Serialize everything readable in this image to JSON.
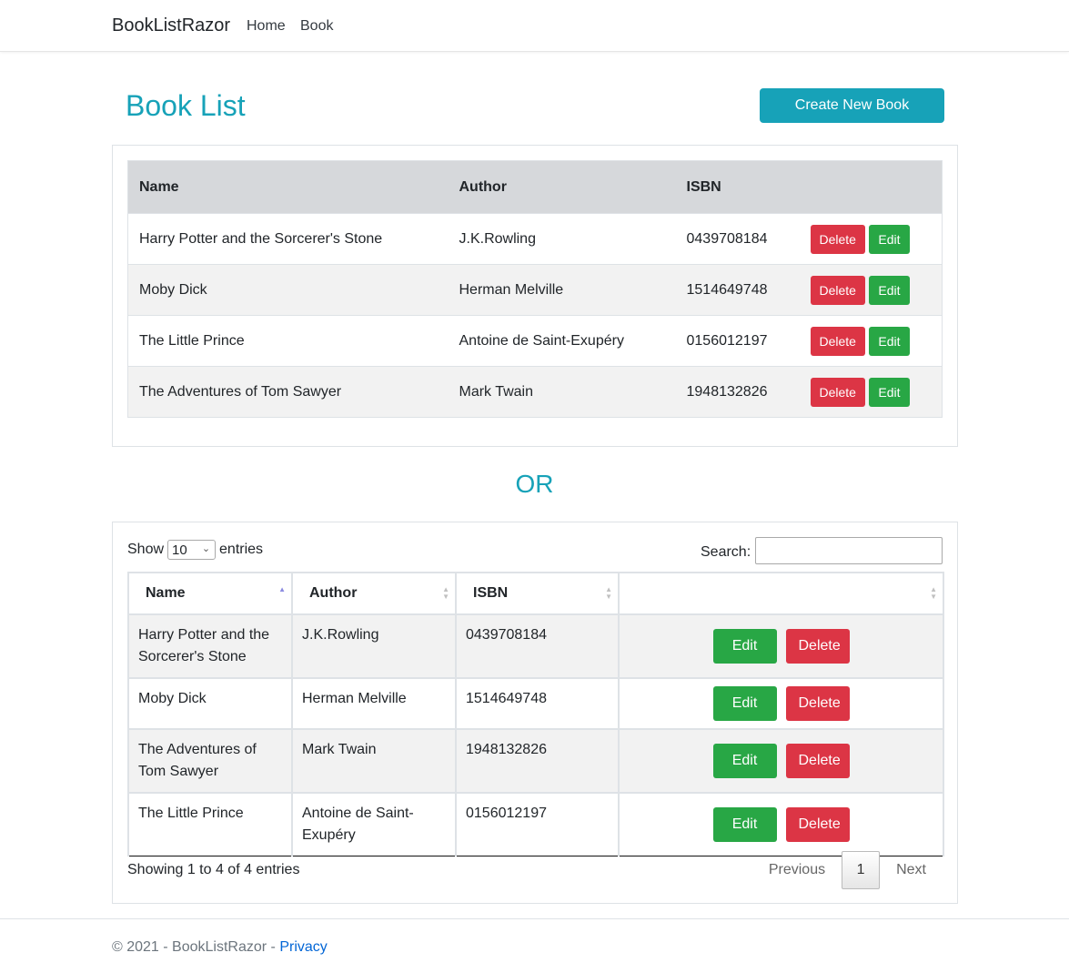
{
  "navbar": {
    "brand": "BookListRazor",
    "links": [
      "Home",
      "Book"
    ]
  },
  "header": {
    "title": "Book List",
    "create_button": "Create New Book"
  },
  "table1": {
    "columns": [
      "Name",
      "Author",
      "ISBN"
    ],
    "rows": [
      {
        "name": "Harry Potter and the Sorcerer's Stone",
        "author": "J.K.Rowling",
        "isbn": "0439708184"
      },
      {
        "name": "Moby Dick",
        "author": "Herman Melville",
        "isbn": "1514649748"
      },
      {
        "name": "The Little Prince",
        "author": "Antoine de Saint-Exupéry",
        "isbn": "0156012197"
      },
      {
        "name": "The Adventures of Tom Sawyer",
        "author": "Mark Twain",
        "isbn": "1948132826"
      }
    ],
    "delete_label": "Delete",
    "edit_label": "Edit"
  },
  "or_text": "OR",
  "datatable": {
    "show_label": "Show",
    "entries_label": "entries",
    "page_length": "10",
    "search_label": "Search:",
    "search_value": "",
    "columns": [
      "Name",
      "Author",
      "ISBN",
      ""
    ],
    "rows": [
      {
        "name": "Harry Potter and the Sorcerer's Stone",
        "author": "J.K.Rowling",
        "isbn": "0439708184"
      },
      {
        "name": "Moby Dick",
        "author": "Herman Melville",
        "isbn": "1514649748"
      },
      {
        "name": "The Adventures of Tom Sawyer",
        "author": "Mark Twain",
        "isbn": "1948132826"
      },
      {
        "name": "The Little Prince",
        "author": "Antoine de Saint-Exupéry",
        "isbn": "0156012197"
      }
    ],
    "edit_label": "Edit",
    "delete_label": "Delete",
    "info": "Showing 1 to 4 of 4 entries",
    "prev_label": "Previous",
    "current_page": "1",
    "next_label": "Next"
  },
  "footer": {
    "text": "© 2021 - BookListRazor - ",
    "privacy_link": "Privacy"
  },
  "colors": {
    "accent": "#17a2b8",
    "danger": "#dc3545",
    "success": "#28a745"
  }
}
